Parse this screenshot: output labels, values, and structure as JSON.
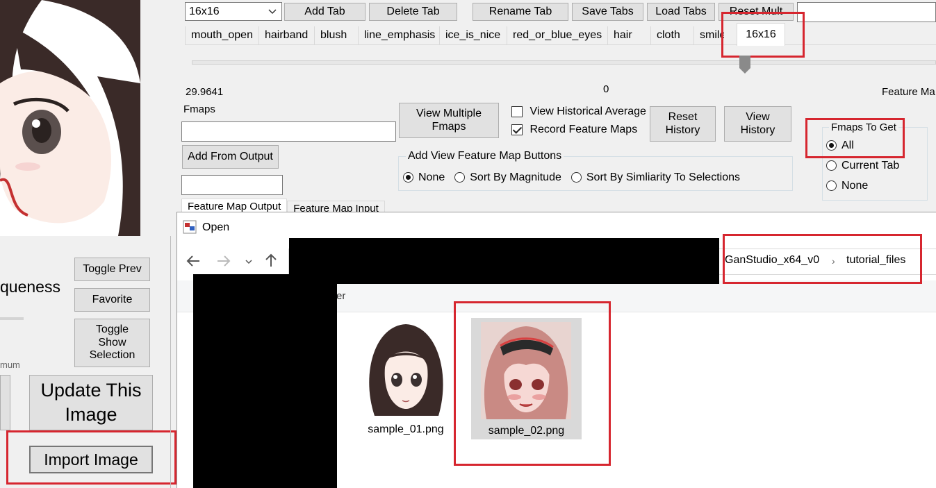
{
  "top_controls": {
    "tab_select_value": "16x16",
    "add_tab": "Add Tab",
    "delete_tab": "Delete Tab",
    "rename_tab": "Rename Tab",
    "save_tabs": "Save Tabs",
    "load_tabs": "Load Tabs",
    "reset_mult": "Reset Mult",
    "mult_input_value": ""
  },
  "feature_tabs": [
    "mouth_open",
    "hairband",
    "blush",
    "line_emphasis",
    "ice_is_nice",
    "red_or_blue_eyes",
    "hair",
    "cloth",
    "smile"
  ],
  "active_tab": "16x16",
  "slider": {
    "min_label": "29.9641",
    "value_label": "0",
    "right_label": "Feature Ma",
    "position_fraction": 0.736
  },
  "fmaps_panel": {
    "fmaps_label": "Fmaps",
    "fmaps_input_value": "",
    "view_multiple_fmaps": "View Multiple Fmaps",
    "add_from_output": "Add From Output",
    "small_input_value": "",
    "view_historical_average": "View Historical Average",
    "view_historical_average_checked": false,
    "record_feature_maps": "Record Feature Maps",
    "record_feature_maps_checked": true,
    "reset_history": "Reset History",
    "view_history": "View History",
    "add_view_group_title": "Add View Feature Map Buttons",
    "add_view_options": [
      {
        "label": "None",
        "checked": true
      },
      {
        "label": "Sort By Magnitude",
        "checked": false
      },
      {
        "label": "Sort By Simliarity To Selections",
        "checked": false
      }
    ],
    "fmaps_to_get_title": "Fmaps To Get",
    "fmaps_to_get_options": [
      {
        "label": "All",
        "checked": true
      },
      {
        "label": "Current Tab",
        "checked": false
      },
      {
        "label": "None",
        "checked": false
      }
    ],
    "bottom_tabs": [
      "Feature Map Output",
      "Feature Map Input"
    ]
  },
  "left_panel": {
    "uniqueness_label": "queness",
    "minimum_label": "mum",
    "toggle_prev": "Toggle Prev",
    "favorite": "Favorite",
    "toggle_show_selection": "Toggle Show Selection",
    "update_this_image": "Update This Image",
    "import_image": "Import Image"
  },
  "open_dialog": {
    "title": "Open",
    "path_segments": [
      "GanStudio_x64_v0",
      "tutorial_files"
    ],
    "toolbar_text": "er",
    "files": [
      {
        "name": "sample_01.png",
        "selected": false
      },
      {
        "name": "sample_02.png",
        "selected": true
      }
    ]
  },
  "colors": {
    "highlight": "#d6262f",
    "button_bg": "#e1e1e1",
    "window_bg": "#f0f0f0",
    "redaction": "#000000"
  }
}
